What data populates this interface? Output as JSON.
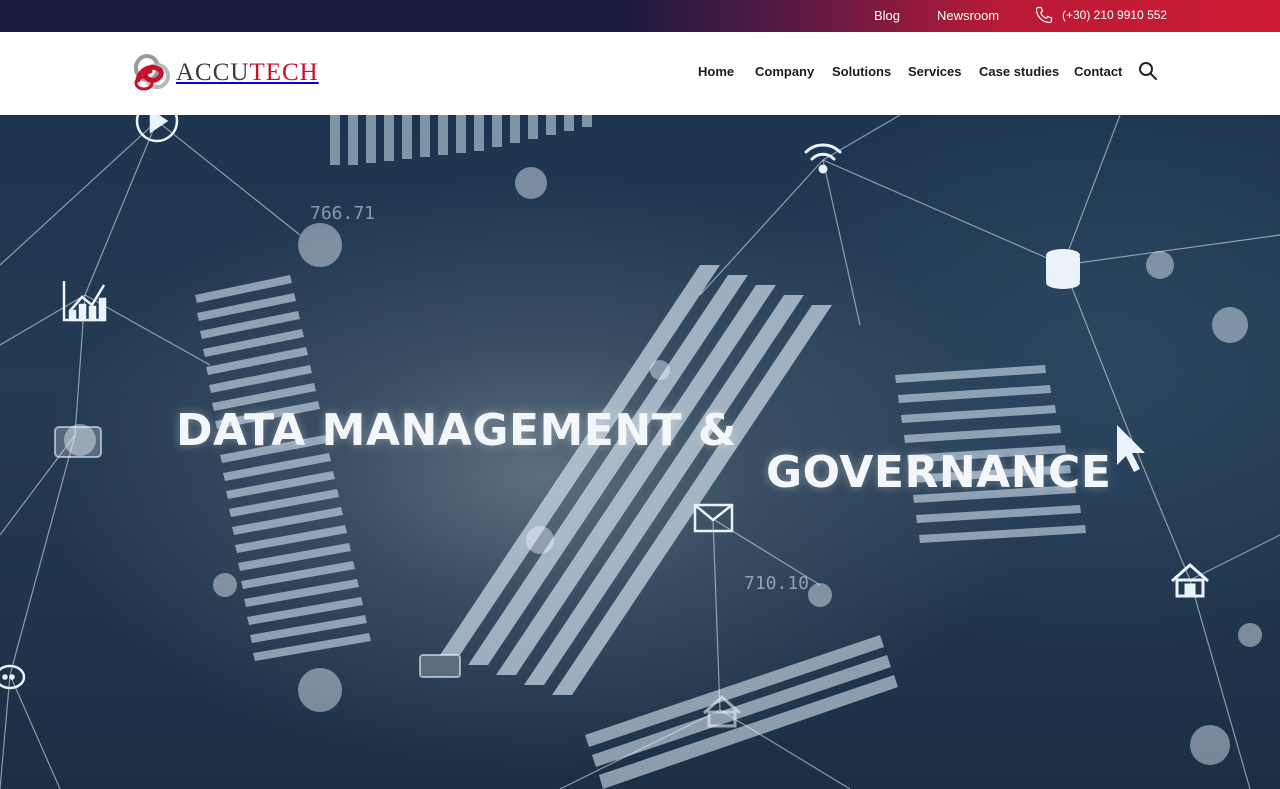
{
  "topbar": {
    "blog": "Blog",
    "newsroom": "Newsroom",
    "phone": "(+30) 210 9910 552",
    "phone_icon": "phone-icon"
  },
  "header": {
    "logo_text_a": "ACCU",
    "logo_text_b": "TECH",
    "nav": {
      "home": "Home",
      "company": "Company",
      "solutions": "Solutions",
      "services": "Services",
      "case_studies": "Case studies",
      "contact": "Contact"
    },
    "search_icon": "search-icon"
  },
  "hero": {
    "title_line_1": "DATA MANAGEMENT &",
    "title_line_2": "GOVERNANCE",
    "overlay_number_1": "766.71",
    "overlay_number_2": "710.10",
    "icons": [
      "play-icon",
      "wifi-icon",
      "database-icon",
      "chart-icon",
      "mail-icon",
      "cursor-icon",
      "home-icon",
      "chat-icon"
    ]
  },
  "colors": {
    "topbar_dark": "#181a3e",
    "brand_red": "#c8102e",
    "nav_text": "#1c1c1c"
  }
}
